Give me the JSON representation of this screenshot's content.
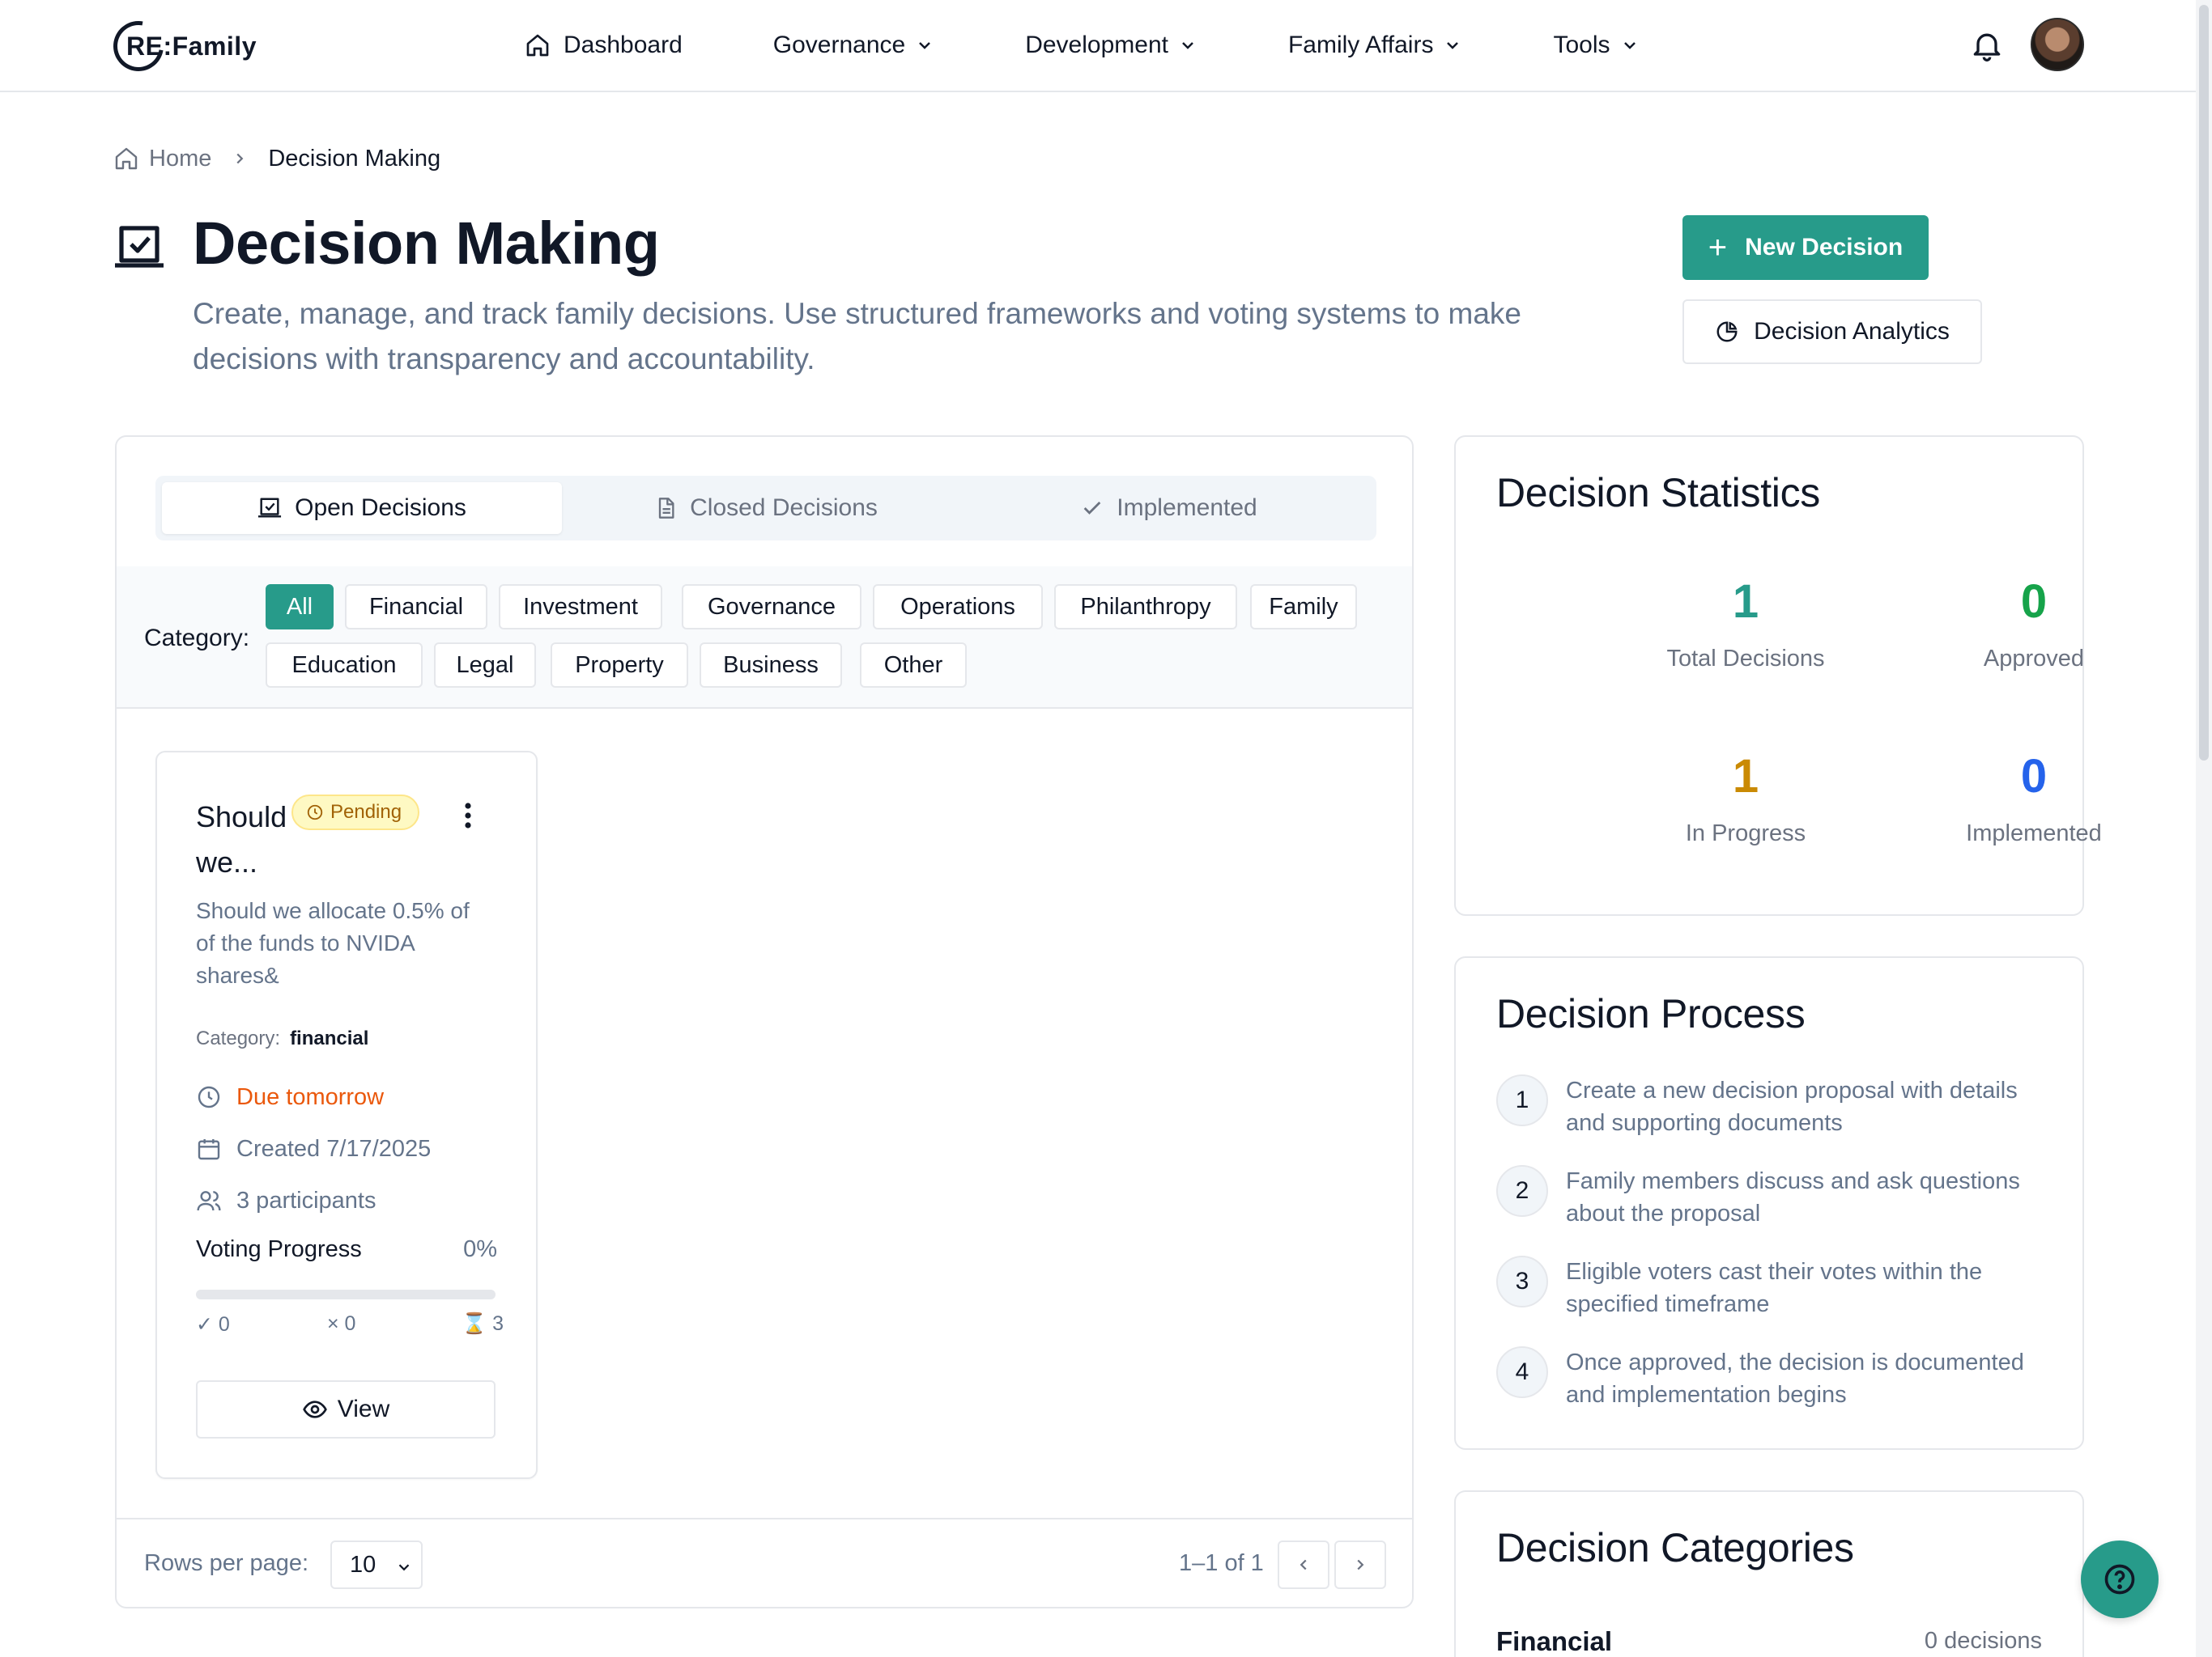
{
  "brand": {
    "logo_text": "RE:Family"
  },
  "nav": {
    "dashboard": "Dashboard",
    "governance": "Governance",
    "development": "Development",
    "family_affairs": "Family Affairs",
    "tools": "Tools"
  },
  "breadcrumb": {
    "home": "Home",
    "current": "Decision Making"
  },
  "page": {
    "title": "Decision Making",
    "description": "Create, manage, and track family decisions. Use structured frameworks and voting systems to make decisions with transparency and accountability."
  },
  "actions": {
    "new_decision": "New Decision",
    "analytics": "Decision Analytics"
  },
  "tabs": [
    {
      "label": "Open Decisions"
    },
    {
      "label": "Closed Decisions"
    },
    {
      "label": "Implemented"
    }
  ],
  "filter": {
    "label": "Category:",
    "chips": [
      "All",
      "Financial",
      "Investment",
      "Governance",
      "Operations",
      "Philanthropy",
      "Family",
      "Education",
      "Legal",
      "Property",
      "Business",
      "Other"
    ],
    "selected": "All"
  },
  "decision": {
    "title_line1": "Should",
    "title_line2": "we...",
    "status": "Pending",
    "description": "Should we allocate 0.5% of of the funds to NVIDA shares&",
    "category_label": "Category:",
    "category_value": "financial",
    "due": "Due tomorrow",
    "created": "Created 7/17/2025",
    "participants": "3 participants",
    "progress_label": "Voting Progress",
    "progress_text": "0%",
    "progress_value": 0,
    "votes_yes": "0",
    "votes_no": "0",
    "votes_pending": "3",
    "view_label": "View"
  },
  "pagination": {
    "rows_label": "Rows per page:",
    "rows_value": "10",
    "range": "1–1 of 1"
  },
  "stats": {
    "title": "Decision Statistics",
    "items": [
      {
        "value": "1",
        "label": "Total Decisions",
        "color": "#279b8a"
      },
      {
        "value": "0",
        "label": "Approved",
        "color": "#16a34a"
      },
      {
        "value": "1",
        "label": "In Progress",
        "color": "#ca8a04"
      },
      {
        "value": "0",
        "label": "Implemented",
        "color": "#2563eb"
      }
    ]
  },
  "process": {
    "title": "Decision Process",
    "steps": [
      {
        "num": "1",
        "text": "Create a new decision proposal with details and supporting documents"
      },
      {
        "num": "2",
        "text": "Family members discuss and ask questions about the proposal"
      },
      {
        "num": "3",
        "text": "Eligible voters cast their votes within the specified timeframe"
      },
      {
        "num": "4",
        "text": "Once approved, the decision is documented and implementation begins"
      }
    ]
  },
  "categories": {
    "title": "Decision Categories",
    "rows": [
      {
        "name": "Financial",
        "count": "0 decisions"
      }
    ]
  },
  "colors": {
    "accent": "#279b8a",
    "pending_bg": "#fef9c3",
    "due": "#ea580c"
  },
  "icons": [
    "home-icon",
    "chevron-down-icon",
    "bell-icon",
    "checkbox-icon",
    "plus-icon",
    "pie-chart-icon",
    "document-icon",
    "check-icon",
    "clock-icon",
    "kebab-icon",
    "calendar-icon",
    "users-icon",
    "hourglass-icon",
    "eye-icon",
    "chevron-left-icon",
    "chevron-right-icon",
    "help-icon"
  ]
}
